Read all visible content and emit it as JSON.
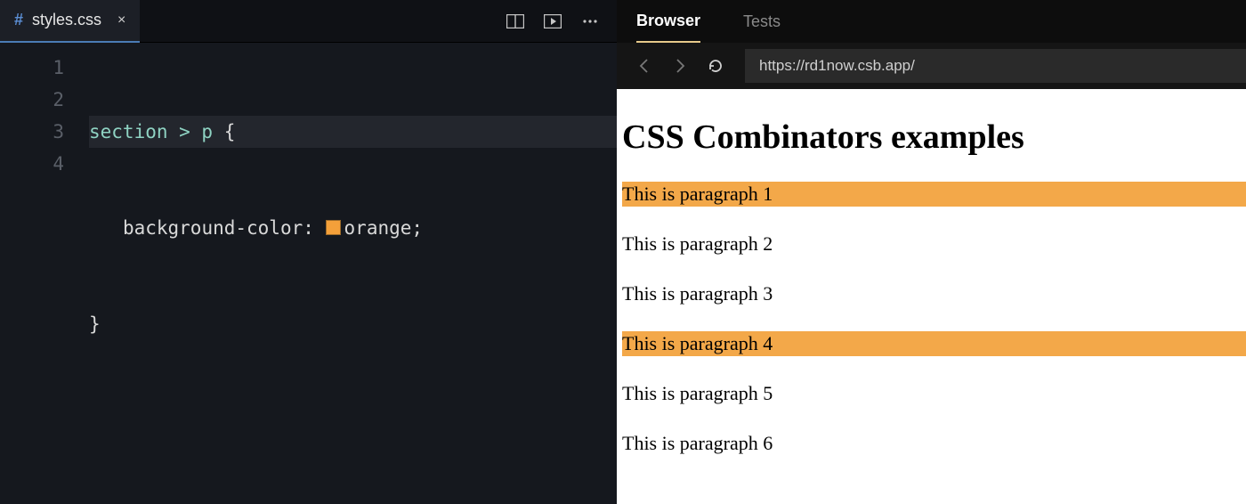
{
  "editor": {
    "tab": {
      "icon_label": "#",
      "filename": "styles.css",
      "close_glyph": "×"
    },
    "toolbar": {
      "split_icon": "split-layout-icon",
      "preview_icon": "preview-play-icon",
      "more_icon": "more-icon"
    },
    "gutter": [
      "1",
      "2",
      "3",
      "4"
    ],
    "code": {
      "line1": {
        "selector": "section > p",
        "brace_open": " {"
      },
      "line2": {
        "indent": "   ",
        "prop": "background-color",
        "colon": ": ",
        "value": "orange",
        "semicolon": ";"
      },
      "line3": {
        "brace_close": "}"
      },
      "line4": ""
    }
  },
  "preview": {
    "tabs": {
      "browser": "Browser",
      "tests": "Tests"
    },
    "nav": {
      "back": "‹",
      "forward": "›"
    },
    "url": "https://rd1now.csb.app/",
    "page": {
      "heading": "CSS Combinators examples",
      "paragraphs": [
        {
          "text": "This is paragraph 1",
          "highlighted": true
        },
        {
          "text": "This is paragraph 2",
          "highlighted": false
        },
        {
          "text": "This is paragraph 3",
          "highlighted": false
        },
        {
          "text": "This is paragraph 4",
          "highlighted": true
        },
        {
          "text": "This is paragraph 5",
          "highlighted": false
        },
        {
          "text": "This is paragraph 6",
          "highlighted": false
        }
      ]
    }
  }
}
